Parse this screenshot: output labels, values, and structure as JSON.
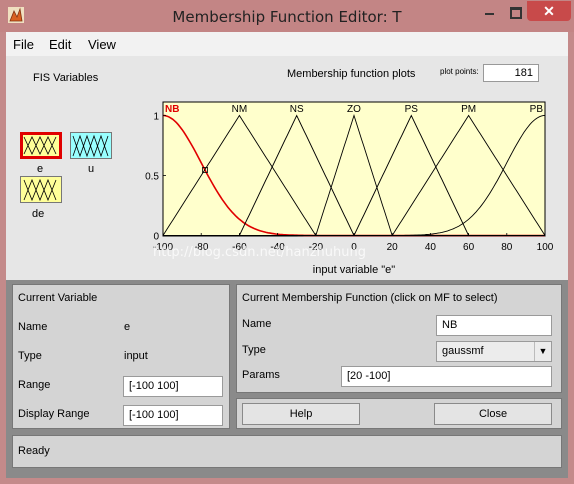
{
  "window": {
    "title": "Membership Function Editor: T",
    "close_glyph": "✕"
  },
  "menu": {
    "items": [
      "File",
      "Edit",
      "View"
    ]
  },
  "fis": {
    "heading": "FIS Variables",
    "variables": [
      {
        "label": "e",
        "selected": true,
        "kind": "input",
        "color": "#ffff99"
      },
      {
        "label": "u",
        "selected": false,
        "kind": "output",
        "color": "#99ffff"
      },
      {
        "label": "de",
        "selected": false,
        "kind": "input",
        "color": "#ffff99"
      }
    ]
  },
  "plot": {
    "title": "Membership function plots",
    "plot_points_label": "plot points:",
    "plot_points_value": "181",
    "watermark": "http://blog.csdn.net/hanzhuhung"
  },
  "chart_data": {
    "type": "line",
    "xlabel": "input variable \"e\"",
    "xlim": [
      -100,
      100
    ],
    "ylim": [
      0,
      1
    ],
    "xticks": [
      "-100",
      "-80",
      "-60",
      "-40",
      "-20",
      "0",
      "20",
      "40",
      "60",
      "80",
      "100"
    ],
    "yticks": [
      "0",
      "0.5",
      "1"
    ],
    "background": "#ffffcc",
    "series": [
      {
        "name": "NB",
        "mf": "gaussmf",
        "params": [
          20,
          -100
        ],
        "color": "#e00000",
        "selected": true
      },
      {
        "name": "NM",
        "mf": "trimf",
        "params": [
          -100,
          -60,
          -20
        ],
        "color": "#000000"
      },
      {
        "name": "NS",
        "mf": "trimf",
        "params": [
          -60,
          -30,
          0
        ],
        "color": "#000000"
      },
      {
        "name": "ZO",
        "mf": "trimf",
        "params": [
          -20,
          0,
          20
        ],
        "color": "#000000"
      },
      {
        "name": "PS",
        "mf": "trimf",
        "params": [
          0,
          30,
          60
        ],
        "color": "#000000"
      },
      {
        "name": "PM",
        "mf": "trimf",
        "params": [
          20,
          60,
          100
        ],
        "color": "#000000"
      },
      {
        "name": "PB",
        "mf": "gaussmf",
        "params": [
          20,
          100
        ],
        "color": "#000000"
      }
    ]
  },
  "current_variable": {
    "heading": "Current Variable",
    "name_label": "Name",
    "name_value": "e",
    "type_label": "Type",
    "type_value": "input",
    "range_label": "Range",
    "range_value": "[-100 100]",
    "display_range_label": "Display Range",
    "display_range_value": "[-100 100]"
  },
  "current_mf": {
    "heading": "Current Membership Function (click on MF to select)",
    "name_label": "Name",
    "name_value": "NB",
    "type_label": "Type",
    "type_value": "gaussmf",
    "params_label": "Params",
    "params_value": "[20 -100]"
  },
  "buttons": {
    "help": "Help",
    "close": "Close"
  },
  "status": {
    "text": "Ready"
  }
}
